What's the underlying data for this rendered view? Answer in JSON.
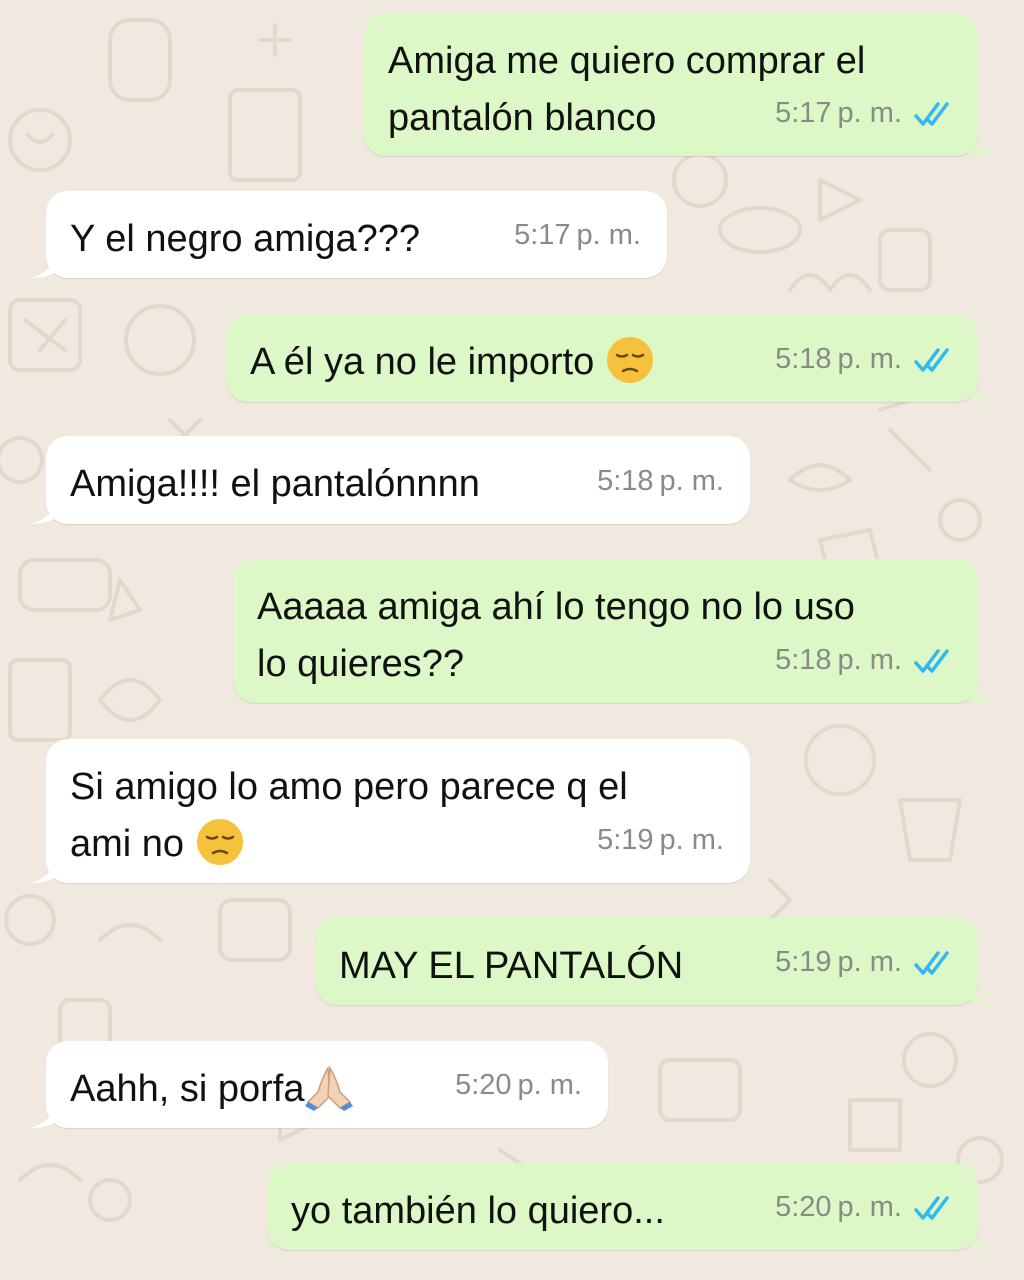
{
  "conversation": {
    "messages": [
      {
        "direction": "out",
        "text": "Amiga me quiero comprar el\npantalón blanco",
        "time": "5:17",
        "ampm": "p. m.",
        "read_status": "double-check-read"
      },
      {
        "direction": "in",
        "text": "Y el negro amiga???",
        "time": "5:17",
        "ampm": "p. m."
      },
      {
        "direction": "out",
        "text": "A él ya no le importo ",
        "emoji": "pensive-face",
        "time": "5:18",
        "ampm": "p. m.",
        "read_status": "double-check-read"
      },
      {
        "direction": "in",
        "text": "Amiga!!!! el pantalónnnn",
        "time": "5:18",
        "ampm": "p. m."
      },
      {
        "direction": "out",
        "text": "Aaaaa amiga ahí lo tengo no lo uso\nlo quieres??",
        "time": "5:18",
        "ampm": "p. m.",
        "read_status": "double-check-read"
      },
      {
        "direction": "in",
        "text": "Si amigo lo amo pero parece q el\nami no ",
        "emoji": "pensive-face",
        "time": "5:19",
        "ampm": "p. m."
      },
      {
        "direction": "out",
        "text": "MAY EL PANTALÓN",
        "time": "5:19",
        "ampm": "p. m.",
        "read_status": "double-check-read"
      },
      {
        "direction": "in",
        "text": "Aahh, si porfa",
        "emoji": "folded-hands",
        "time": "5:20",
        "ampm": "p. m."
      },
      {
        "direction": "out",
        "text": "yo también lo quiero...",
        "time": "5:20",
        "ampm": "p. m.",
        "read_status": "double-check-read"
      }
    ]
  },
  "colors": {
    "wallpaper": "#efe9e0",
    "outgoing_bubble": "#dcf8c6",
    "incoming_bubble": "#ffffff",
    "read_check": "#34b7f1",
    "timestamp": "#8a8a88"
  }
}
